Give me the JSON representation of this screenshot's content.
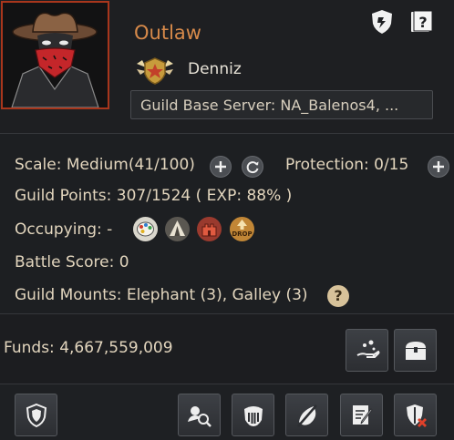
{
  "guild": {
    "name": "Outlaw",
    "master": "Denniz",
    "server": "Guild Base Server: NA_Balenos4, ..."
  },
  "stats": {
    "scale_label": "Scale:",
    "scale_value": "Medium(41/100)",
    "protection_label": "Protection:",
    "protection_value": "0/15",
    "points_label": "Guild Points:",
    "points_value": "307/1524 ( EXP: 88% )",
    "occupying_label": "Occupying:",
    "occupying_value": "-",
    "battle_label": "Battle Score:",
    "battle_value": "0",
    "mounts_label": "Guild Mounts:",
    "mounts_value": "Elephant (3), Galley (3)"
  },
  "funds": {
    "label": "Funds:",
    "value": "4,667,559,009"
  },
  "help_glyph": "?",
  "occupy_icons": [
    "palette-icon",
    "camp-tent-icon",
    "fortress-icon",
    "drop-bonus-icon"
  ],
  "occupy_drop_text": "DROP",
  "colors": {
    "accent": "#d88a4a",
    "emblem_border": "#a8361c",
    "text": "#e3d6be"
  }
}
